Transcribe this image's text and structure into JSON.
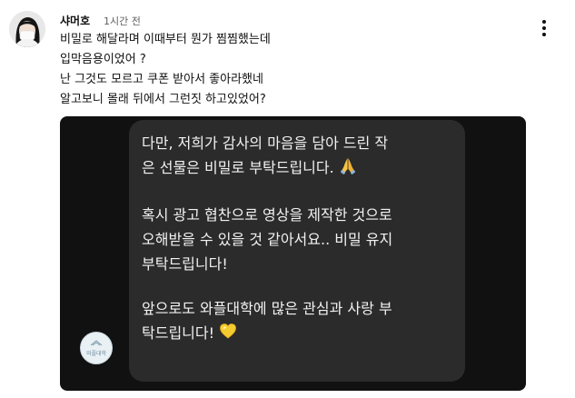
{
  "comment": {
    "author": "샤머호",
    "time": "1시간 전",
    "lines": [
      "비밀로 해달라며 이때부터 뭔가 찜찜했는데",
      "입막음용이었어 ?",
      "난 그것도 모르고 쿠폰 받아서 좋아라했네",
      "알고보니 몰래 뒤에서 그런짓 하고있었어?"
    ]
  },
  "image": {
    "sender_avatar_text": "와플대학",
    "message": {
      "p1": [
        "다만, 저희가 감사의 마음을 담아 드린 작",
        "은 선물은 비밀로 부탁드립니다."
      ],
      "p2": [
        "혹시 광고 협찬으로 영상을 제작한 것으로",
        "오해받을 수 있을 것 같아서요.. 비밀 유지",
        "부탁드립니다!"
      ],
      "p3": [
        "앞으로도 와플대학에 많은 관심과 사랑 부",
        "탁드립니다!"
      ]
    },
    "icons": [
      "praying-hands-emoji",
      "yellow-heart-emoji"
    ]
  },
  "colors": {
    "background": "#ffffff",
    "chat_background": "#111111",
    "bubble_background": "#2b2b2b",
    "bubble_text": "#f2f2f2",
    "secondary_text": "#606060"
  }
}
